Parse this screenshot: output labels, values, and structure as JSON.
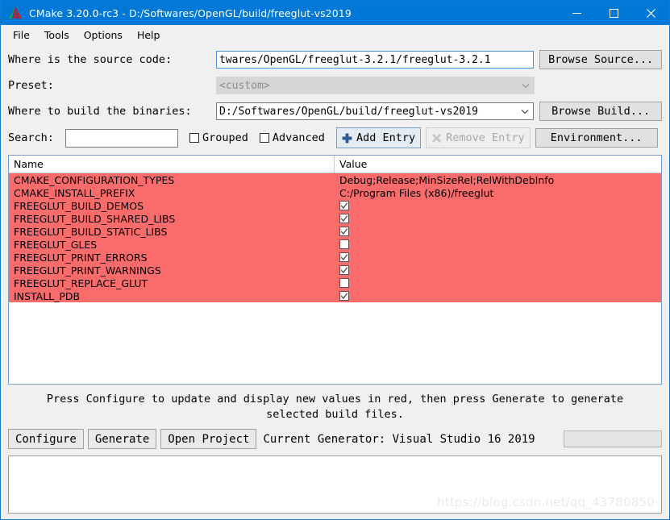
{
  "window": {
    "title": "CMake 3.20.0-rc3 - D:/Softwares/OpenGL/build/freeglut-vs2019",
    "icon": "cmake-logo-icon",
    "minimize": "—",
    "maximize": "□",
    "close": "✕",
    "accent_color": "#0078d7"
  },
  "menubar": {
    "items": [
      {
        "label": "File"
      },
      {
        "label": "Tools"
      },
      {
        "label": "Options"
      },
      {
        "label": "Help"
      }
    ]
  },
  "form": {
    "source_label": "Where is the source code:",
    "source_value": "twares/OpenGL/freeglut-3.2.1/freeglut-3.2.1",
    "browse_source_label": "Browse Source...",
    "preset_label": "Preset:",
    "preset_value": "<custom>",
    "binaries_label": "Where to build the binaries:",
    "binaries_value": "D:/Softwares/OpenGL/build/freeglut-vs2019",
    "browse_build_label": "Browse Build...",
    "search_label": "Search:",
    "search_value": "",
    "grouped_label": "Grouped",
    "grouped_checked": false,
    "advanced_label": "Advanced",
    "advanced_checked": false,
    "add_entry_label": "Add Entry",
    "remove_entry_label": "Remove Entry",
    "environment_label": "Environment..."
  },
  "cache_table": {
    "columns": [
      "Name",
      "Value"
    ],
    "row_color": "#fa6c6c",
    "rows": [
      {
        "name": "CMAKE_CONFIGURATION_TYPES",
        "type": "text",
        "value": "Debug;Release;MinSizeRel;RelWithDebInfo"
      },
      {
        "name": "CMAKE_INSTALL_PREFIX",
        "type": "text",
        "value": "C:/Program Files (x86)/freeglut"
      },
      {
        "name": "FREEGLUT_BUILD_DEMOS",
        "type": "bool",
        "value": true
      },
      {
        "name": "FREEGLUT_BUILD_SHARED_LIBS",
        "type": "bool",
        "value": true
      },
      {
        "name": "FREEGLUT_BUILD_STATIC_LIBS",
        "type": "bool",
        "value": true
      },
      {
        "name": "FREEGLUT_GLES",
        "type": "bool",
        "value": false
      },
      {
        "name": "FREEGLUT_PRINT_ERRORS",
        "type": "bool",
        "value": true
      },
      {
        "name": "FREEGLUT_PRINT_WARNINGS",
        "type": "bool",
        "value": true
      },
      {
        "name": "FREEGLUT_REPLACE_GLUT",
        "type": "bool",
        "value": false
      },
      {
        "name": "INSTALL_PDB",
        "type": "bool",
        "value": true
      }
    ]
  },
  "status": {
    "message_line1": "Press Configure to update and display new values in red, then press Generate to generate",
    "message_line2": "selected build files."
  },
  "actions": {
    "configure_label": "Configure",
    "generate_label": "Generate",
    "open_project_label": "Open Project",
    "current_generator": "Current Generator: Visual Studio 16 2019",
    "progress_value": 0
  },
  "output": {
    "text": "",
    "watermark": "https://blog.csdn.net/qq_43780850"
  }
}
